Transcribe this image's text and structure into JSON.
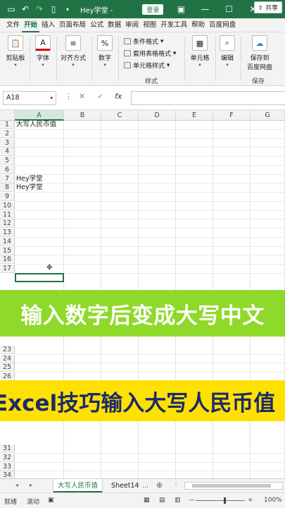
{
  "titlebar": {
    "doc_title": "Hey学堂  -",
    "login_label": "登录",
    "icons": [
      "save-icon",
      "undo-icon",
      "redo-icon",
      "file-icon",
      "dropdown-icon",
      "ribbon-display-icon",
      "minimize-icon",
      "maximize-icon",
      "close-icon"
    ]
  },
  "ribbon_tabs": [
    "文件",
    "开始",
    "插入",
    "页面布局",
    "公式",
    "数据",
    "审阅",
    "视图",
    "开发工具",
    "帮助",
    "百度网盘"
  ],
  "share_label": "共享",
  "ribbon": {
    "paste": "剪贴板",
    "font": "字体",
    "align": "对齐方式",
    "number": "数字",
    "conditional": "条件格式",
    "table_format": "套用表格格式",
    "cell_style": "单元格样式",
    "style_group": "样式",
    "cells": "单元格",
    "edit": "编辑",
    "save_line1": "保存到",
    "save_line2": "百度网盘",
    "save_group": "保存"
  },
  "formula_bar": {
    "name_box": "A18",
    "formula": ""
  },
  "columns": [
    "A",
    "B",
    "C",
    "D",
    "E",
    "F",
    "G"
  ],
  "rows_top": [
    "1",
    "2",
    "3",
    "4",
    "5",
    "6",
    "7",
    "8",
    "9",
    "10",
    "11",
    "12",
    "13",
    "14",
    "15",
    "16",
    "17"
  ],
  "rows_mid": [
    "23",
    "24",
    "25",
    "26"
  ],
  "rows_bottom": [
    "31",
    "32",
    "33",
    "34",
    "35",
    "36"
  ],
  "cells": {
    "A1": "大写人民币值",
    "A7": "Hey学堂",
    "A8": "Hey学堂"
  },
  "overlays": {
    "green_caption": "输入数字后变成大写中文",
    "yellow_caption": "Excel技巧输入大写人民币值"
  },
  "sheet_tabs": {
    "active": "大写人民币值",
    "other": "Sheet14",
    "more": "..."
  },
  "status": {
    "ready": "就绪",
    "scroll": "滚动",
    "zoom": "100%"
  },
  "colors": {
    "excel_green": "#217346",
    "banner_green": "#8fd92a",
    "banner_yellow": "#ffe100",
    "banner_yellow_text": "#1b2a6b"
  }
}
